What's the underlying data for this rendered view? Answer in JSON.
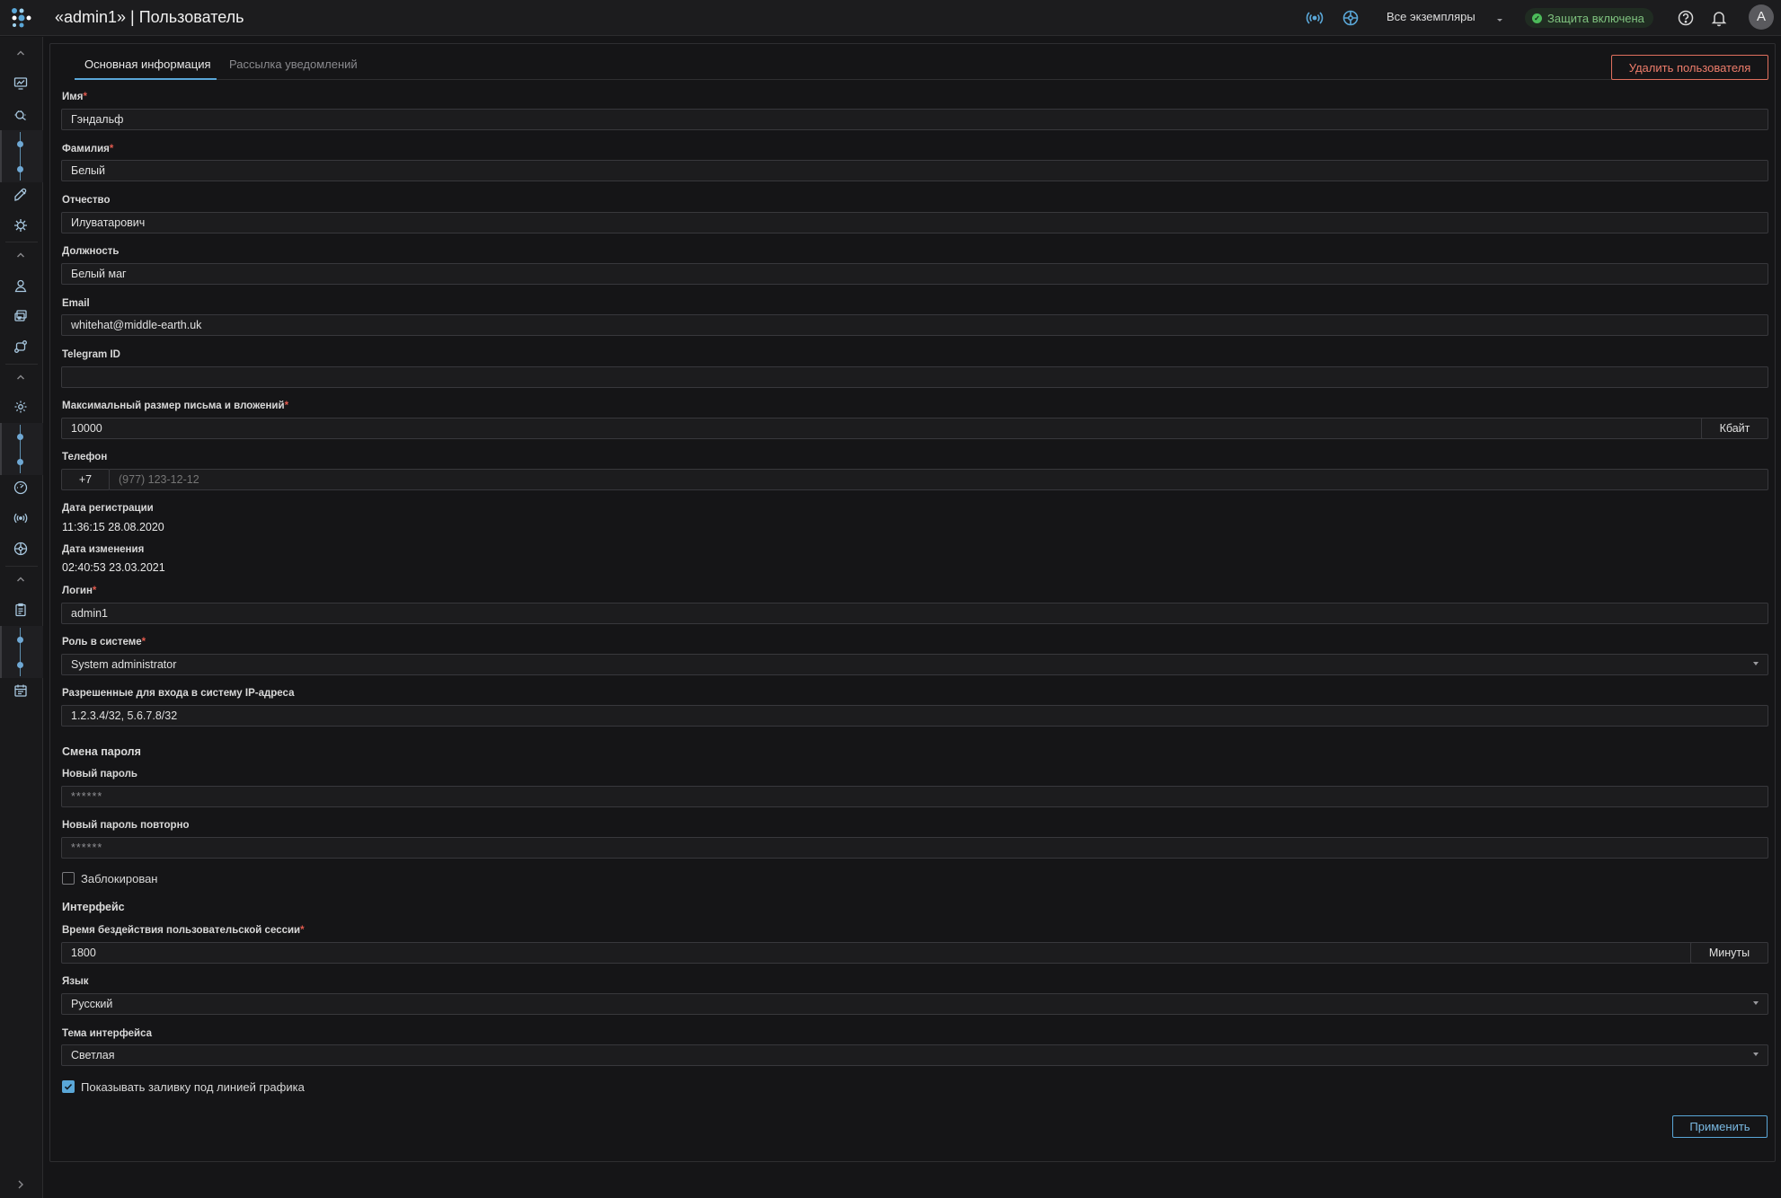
{
  "header": {
    "title": "«admin1» | Пользователь",
    "instances_label": "Все экземпляры",
    "protection_label": "Защита включена",
    "avatar_letter": "A"
  },
  "tabs": [
    {
      "label": "Основная информация",
      "active": true
    },
    {
      "label": "Рассылка уведомлений",
      "active": false
    }
  ],
  "actions": {
    "delete_label": "Удалить пользователя",
    "apply_label": "Применить"
  },
  "form": {
    "first_name": {
      "label": "Имя",
      "value": "Гэндальф"
    },
    "last_name": {
      "label": "Фамилия",
      "value": "Белый"
    },
    "patronymic": {
      "label": "Отчество",
      "value": "Илуватарович"
    },
    "position": {
      "label": "Должность",
      "value": "Белый маг"
    },
    "email": {
      "label": "Email",
      "value": "whitehat@middle-earth.uk"
    },
    "telegram": {
      "label": "Telegram ID",
      "value": ""
    },
    "max_size": {
      "label": "Максимальный размер письма и вложений",
      "value": "10000",
      "unit": "Кбайт"
    },
    "phone": {
      "label": "Телефон",
      "prefix": "+7",
      "placeholder": "(977) 123-12-12"
    },
    "reg_date": {
      "label": "Дата регистрации",
      "value": "11:36:15 28.08.2020"
    },
    "mod_date": {
      "label": "Дата изменения",
      "value": "02:40:53 23.03.2021"
    },
    "login": {
      "label": "Логин",
      "value": "admin1"
    },
    "role": {
      "label": "Роль в системе",
      "value": "System administrator"
    },
    "ips": {
      "label": "Разрешенные для входа в систему IP-адреса",
      "value": "1.2.3.4/32, 5.6.7.8/32"
    },
    "password_section": "Смена пароля",
    "new_password": {
      "label": "Новый пароль",
      "value": "******"
    },
    "new_password_repeat": {
      "label": "Новый пароль повторно",
      "value": "******"
    },
    "blocked": {
      "label": "Заблокирован",
      "checked": false
    },
    "interface_section": "Интерфейс",
    "idle_time": {
      "label": "Время бездействия пользовательской сессии",
      "value": "1800",
      "unit": "Минуты"
    },
    "language": {
      "label": "Язык",
      "value": "Русский"
    },
    "theme": {
      "label": "Тема интерфейса",
      "value": "Светлая"
    },
    "fill_chart": {
      "label": "Показывать заливку под линией графика",
      "checked": true
    }
  },
  "colors": {
    "accent": "#5aa7d8",
    "danger": "#e0705e",
    "success": "#4cbb5a"
  }
}
